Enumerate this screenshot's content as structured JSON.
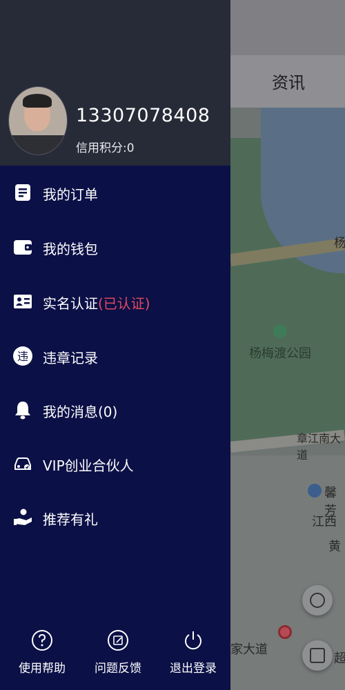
{
  "background": {
    "header_title": "资讯",
    "map_labels": {
      "park": "杨梅渡公园",
      "road": "章江南大道",
      "text_1": "杨",
      "text_2": "江西",
      "text_3": "黄",
      "text_4": "馨芳",
      "text_5": "家大道",
      "text_6": "超"
    }
  },
  "drawer": {
    "phone": "13307078408",
    "credit_label": "信用积分:0",
    "menu": [
      {
        "label": "我的订单",
        "icon": "document-icon"
      },
      {
        "label": "我的钱包",
        "icon": "wallet-icon"
      },
      {
        "label": "实名认证",
        "suffix": "(已认证)",
        "icon": "id-card-icon"
      },
      {
        "label": "违章记录",
        "icon": "violation-icon"
      },
      {
        "label": "我的消息(0)",
        "icon": "bell-icon"
      },
      {
        "label": "VIP创业合伙人",
        "icon": "car-icon"
      },
      {
        "label": "推荐有礼",
        "icon": "gift-icon"
      }
    ],
    "bottom": [
      {
        "label": "使用帮助",
        "icon": "help-icon"
      },
      {
        "label": "问题反馈",
        "icon": "feedback-icon"
      },
      {
        "label": "退出登录",
        "icon": "power-icon"
      }
    ],
    "colors": {
      "drawer_bg": "#0b1046",
      "profile_bg": "#272a37",
      "verified_text": "#e04a5f"
    }
  }
}
